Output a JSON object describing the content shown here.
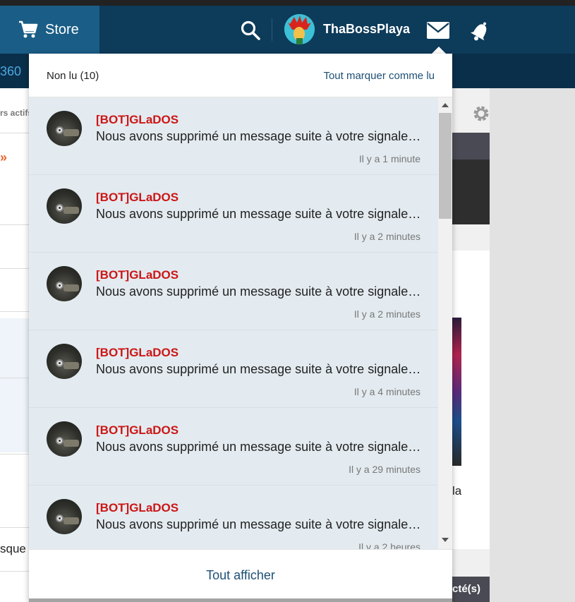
{
  "navbar": {
    "store_label": "Store",
    "username": "ThaBossPlaya",
    "subnav_text": "360"
  },
  "background": {
    "left_users_text": "rs actifs",
    "left_arrow": "»",
    "left_bottom_text": "sque g",
    "right_la_text": "la",
    "right_connect_text": "cté(s)"
  },
  "dropdown": {
    "unread_label": "Non lu (10)",
    "mark_all_label": "Tout marquer comme lu",
    "view_all_label": "Tout afficher",
    "messages": [
      {
        "sender": "[BOT]GLaDOS",
        "text": "Nous avons supprimé un message suite à votre signalement",
        "time": "Il y a 1 minute"
      },
      {
        "sender": "[BOT]GLaDOS",
        "text": "Nous avons supprimé un message suite à votre signalement",
        "time": "Il y a 2 minutes"
      },
      {
        "sender": "[BOT]GLaDOS",
        "text": "Nous avons supprimé un message suite à votre signalement",
        "time": "Il y a 2 minutes"
      },
      {
        "sender": "[BOT]GLaDOS",
        "text": "Nous avons supprimé un message suite à votre signalement",
        "time": "Il y a 4 minutes"
      },
      {
        "sender": "[BOT]GLaDOS",
        "text": "Nous avons supprimé un message suite à votre signalement",
        "time": "Il y a 29 minutes"
      },
      {
        "sender": "[BOT]GLaDOS",
        "text": "Nous avons supprimé un message suite à votre signalement",
        "time": "Il y a 2 heures"
      }
    ]
  },
  "colors": {
    "navbar": "#0d3b5a",
    "store_bg": "#1a5d86",
    "sender": "#cc1616",
    "link": "#1d4f75",
    "message_bg": "#e3ebf0"
  }
}
